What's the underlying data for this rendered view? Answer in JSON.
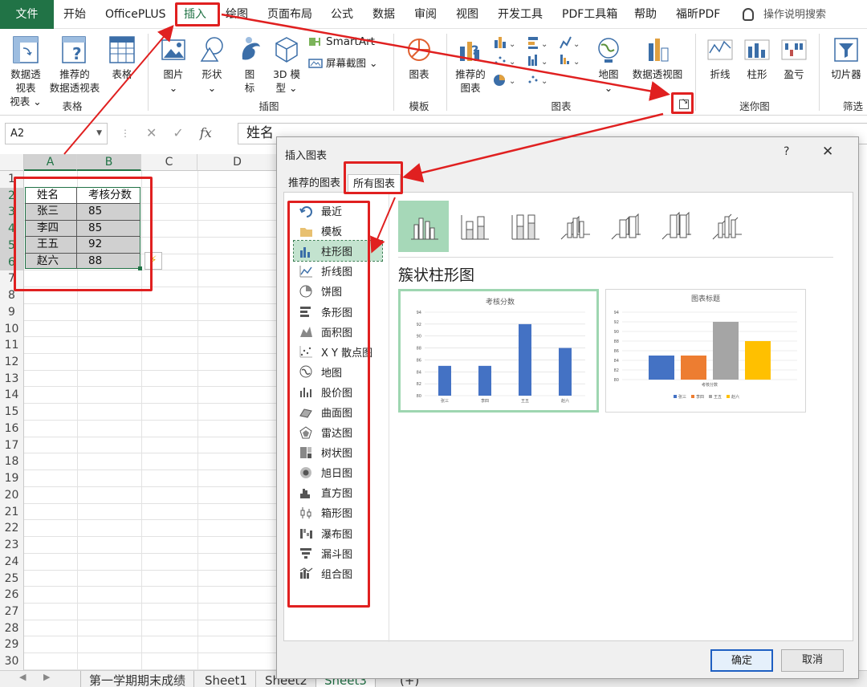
{
  "ribbon": {
    "tabs": [
      "文件",
      "开始",
      "OfficePLUS",
      "插入",
      "绘图",
      "页面布局",
      "公式",
      "数据",
      "审阅",
      "视图",
      "开发工具",
      "PDF工具箱",
      "帮助",
      "福昕PDF"
    ],
    "search_placeholder": "操作说明搜索",
    "buttons": {
      "pivot": "数据透视表",
      "pivot_dd": "视表 ⌄",
      "recommended_pivot": "推荐的",
      "recommended_pivot_2": "数据透视表",
      "table": "表格",
      "pictures": "图片",
      "shapes": "形状",
      "icons": "图",
      "icons_2": "标",
      "model_3d": "3D 模",
      "model_3d_2": "型 ⌄",
      "smartart": "SmartArt",
      "screenshot": "屏幕截图 ⌄",
      "template_chart": "图表",
      "recommended_charts": "推荐的",
      "recommended_charts_2": "图表",
      "maps": "地图",
      "pivot_chart": "数据透视图",
      "spark_line": "折线",
      "spark_column": "柱形",
      "spark_winloss": "盈亏",
      "slicer": "切片器"
    },
    "groups": {
      "tables": "表格",
      "illustrations": "插图",
      "templates": "模板",
      "charts": "图表",
      "sparklines": "迷你图",
      "filters": "筛选"
    }
  },
  "formula_bar": {
    "name_box": "A2",
    "fx": "fx",
    "content": "姓名"
  },
  "sheet": {
    "columns": [
      "A",
      "B",
      "C",
      "D"
    ],
    "rows": [
      "1",
      "2",
      "3",
      "4",
      "5",
      "6",
      "7",
      "8",
      "9",
      "10",
      "11",
      "12",
      "13",
      "14",
      "15",
      "16",
      "17",
      "18",
      "19",
      "20",
      "21",
      "22",
      "23",
      "24",
      "25",
      "26",
      "27",
      "28",
      "29",
      "30"
    ],
    "header": [
      "姓名",
      "考核分数"
    ],
    "data": [
      [
        "张三",
        "85"
      ],
      [
        "李四",
        "85"
      ],
      [
        "王五",
        "92"
      ],
      [
        "赵六",
        "88"
      ]
    ]
  },
  "sheet_tabs": [
    "第一学期期末成绩",
    "Sheet1",
    "Sheet2",
    "Sheet3",
    "(+)"
  ],
  "dialog": {
    "title": "插入图表",
    "help": "?",
    "close": "✕",
    "tabs": [
      "推荐的图表",
      "所有图表"
    ],
    "types": [
      "最近",
      "模板",
      "柱形图",
      "折线图",
      "饼图",
      "条形图",
      "面积图",
      "X Y 散点图",
      "地图",
      "股价图",
      "曲面图",
      "雷达图",
      "树状图",
      "旭日图",
      "直方图",
      "箱形图",
      "瀑布图",
      "漏斗图",
      "组合图"
    ],
    "selected_type": "柱形图",
    "subtype_title": "簇状柱形图",
    "ok": "确定",
    "cancel": "取消"
  },
  "chart_data": [
    {
      "type": "bar",
      "title": "考核分数",
      "categories": [
        "张三",
        "李四",
        "王五",
        "赵六"
      ],
      "values": [
        85,
        85,
        92,
        88
      ],
      "yticks": [
        "94",
        "92",
        "90",
        "88",
        "86",
        "84",
        "82",
        "80"
      ],
      "ylim": [
        80,
        94
      ],
      "color": "#4472c4"
    },
    {
      "type": "bar",
      "title": "图表标题",
      "categories": [
        "考核分数"
      ],
      "series": [
        {
          "name": "张三",
          "values": [
            85
          ],
          "color": "#4472c4"
        },
        {
          "name": "李四",
          "values": [
            85
          ],
          "color": "#ed7d31"
        },
        {
          "name": "王五",
          "values": [
            92
          ],
          "color": "#a5a5a5"
        },
        {
          "name": "赵六",
          "values": [
            88
          ],
          "color": "#ffc000"
        }
      ],
      "yticks": [
        "94",
        "92",
        "90",
        "88",
        "86",
        "84",
        "82",
        "80"
      ],
      "ylim": [
        80,
        94
      ],
      "legend": "bottom"
    }
  ]
}
